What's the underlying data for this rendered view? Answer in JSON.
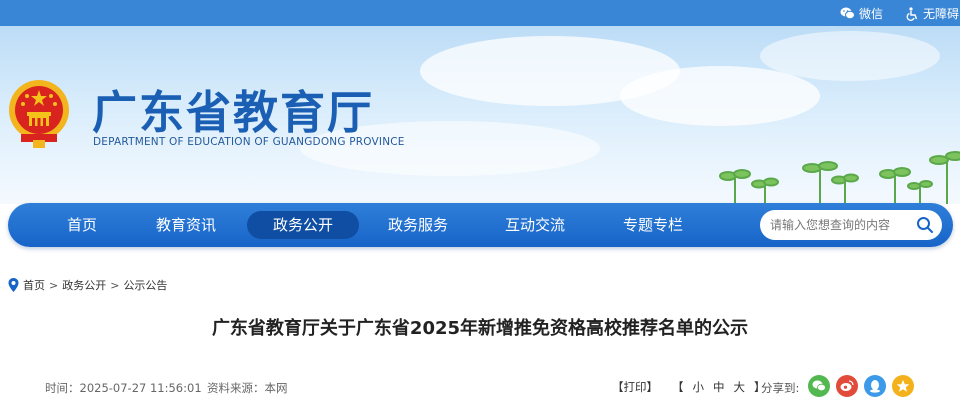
{
  "topbar": {
    "wechat_label": "微信",
    "accessibility_label": "无障碍",
    "color": "#3a86d6"
  },
  "header": {
    "title": "广东省教育厅",
    "subtitle": "DEPARTMENT OF EDUCATION OF GUANGDONG PROVINCE",
    "title_color": "#1a5fb4"
  },
  "nav": {
    "items": [
      {
        "label": "首页",
        "active": false
      },
      {
        "label": "教育资讯",
        "active": false
      },
      {
        "label": "政务公开",
        "active": true
      },
      {
        "label": "政务服务",
        "active": false
      },
      {
        "label": "互动交流",
        "active": false
      },
      {
        "label": "专题专栏",
        "active": false
      }
    ],
    "search_placeholder": "请输入您想查询的内容",
    "color": "#1764c8",
    "active_color": "#0f4ea3"
  },
  "breadcrumb": {
    "items": [
      "首页",
      "政务公开",
      "公示公告"
    ],
    "separator": ">"
  },
  "article": {
    "title": "广东省教育厅关于广东省2025年新增推免资格高校推荐名单的公示",
    "time": "时间：2025-07-27 11:56:01",
    "source": "资料来源：本网",
    "print_label": "【打印】",
    "size_open": "【",
    "size_small": "小",
    "size_medium": "中",
    "size_large": "大",
    "size_close": "】",
    "share_label": "分享到:",
    "share_icons": [
      {
        "name": "wechat-share-icon",
        "color": "#53b84f"
      },
      {
        "name": "weibo-share-icon",
        "color": "#e24a3a"
      },
      {
        "name": "qq-share-icon",
        "color": "#3c9ae8"
      },
      {
        "name": "qzone-share-icon",
        "color": "#f3b21b"
      }
    ]
  }
}
